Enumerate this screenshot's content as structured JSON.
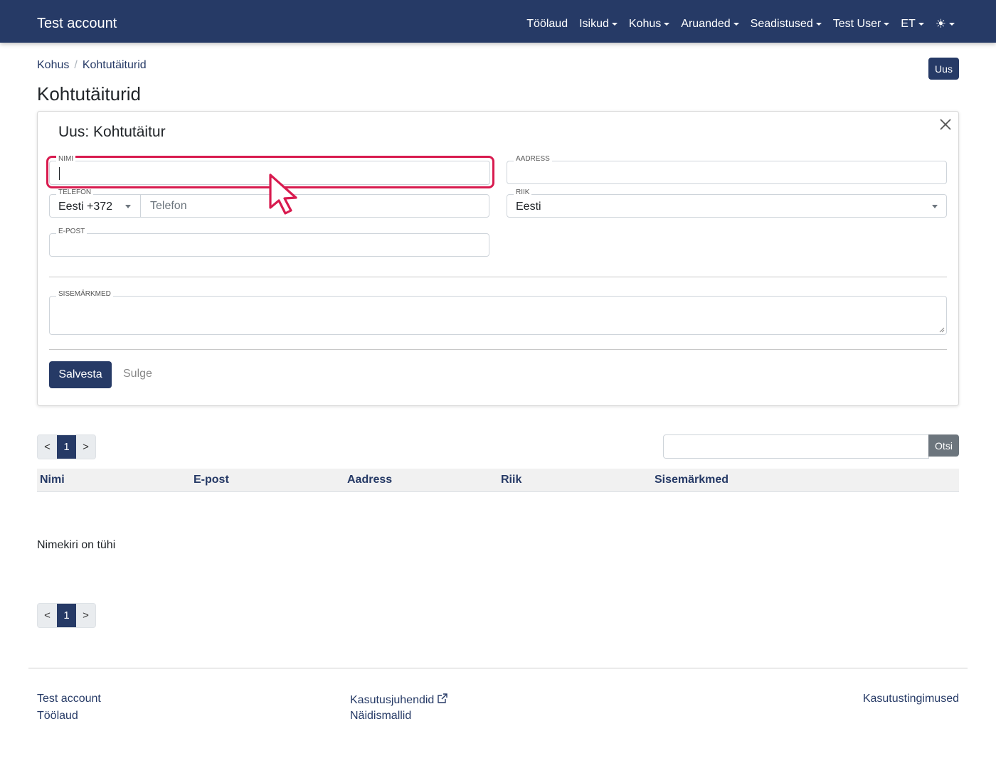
{
  "navbar": {
    "brand": "Test account",
    "items": [
      {
        "label": "Töölaud",
        "dropdown": false
      },
      {
        "label": "Isikud",
        "dropdown": true
      },
      {
        "label": "Kohus",
        "dropdown": true
      },
      {
        "label": "Aruanded",
        "dropdown": true
      },
      {
        "label": "Seadistused",
        "dropdown": true
      },
      {
        "label": "Test User",
        "dropdown": true
      },
      {
        "label": "ET",
        "dropdown": true
      }
    ],
    "theme_icon": "☀"
  },
  "breadcrumb": [
    "Kohus",
    "Kohtutäiturid"
  ],
  "breadcrumb_sep": "/",
  "new_button": "Uus",
  "page_title": "Kohtutäiturid",
  "form": {
    "title": "Uus: Kohtutäitur",
    "fields": {
      "name": {
        "label": "NIMI",
        "value": ""
      },
      "address": {
        "label": "AADRESS",
        "value": ""
      },
      "phone": {
        "label": "TELEFON",
        "country_code": "Eesti +372",
        "placeholder": "Telefon"
      },
      "country": {
        "label": "RIIK",
        "value": "Eesti"
      },
      "email": {
        "label": "E-POST",
        "value": ""
      },
      "notes": {
        "label": "SISEMÄRKMED",
        "value": ""
      }
    },
    "save_button": "Salvesta",
    "close_button": "Sulge"
  },
  "pagination": {
    "prev": "<",
    "current": "1",
    "next": ">"
  },
  "search": {
    "button": "Otsi",
    "value": ""
  },
  "table": {
    "columns": [
      "Nimi",
      "E-post",
      "Aadress",
      "Riik",
      "Sisemärkmed"
    ],
    "empty_text": "Nimekiri on tühi"
  },
  "footer": {
    "col1": [
      "Test account",
      "Töölaud"
    ],
    "col2": [
      "Kasutusjuhendid",
      "Näidismallid"
    ],
    "col3": [
      "Kasutustingimused"
    ]
  },
  "colors": {
    "primary": "#263a66",
    "focus": "#d81b4f",
    "secondary": "#6c757d"
  }
}
